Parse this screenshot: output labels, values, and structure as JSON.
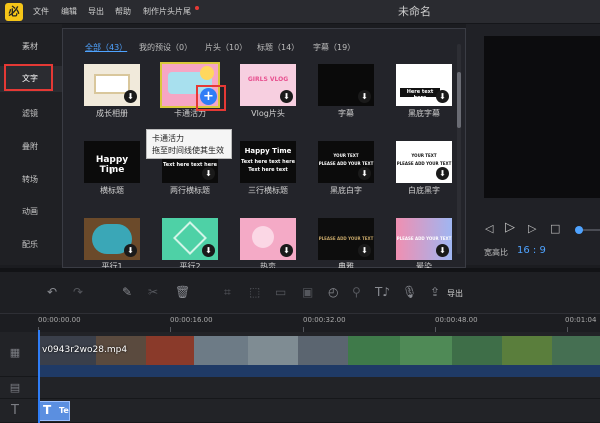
{
  "app": {
    "logo_glyph": "必",
    "title": "未命名"
  },
  "menu": {
    "file": "文件",
    "edit": "编辑",
    "export": "导出",
    "help": "帮助",
    "intro_outro": "制作片头片尾"
  },
  "sidebar": {
    "items": [
      {
        "label": "素材"
      },
      {
        "label": "文字",
        "active": true
      },
      {
        "label": "滤镜"
      },
      {
        "label": "叠附"
      },
      {
        "label": "转场"
      },
      {
        "label": "动画"
      },
      {
        "label": "配乐"
      }
    ]
  },
  "filters": [
    {
      "label": "全部（43）",
      "active": true
    },
    {
      "label": "我的预设（0）"
    },
    {
      "label": "片头（10）"
    },
    {
      "label": "标题（14）"
    },
    {
      "label": "字幕（19）"
    }
  ],
  "templates": {
    "row1": [
      {
        "caption": "成长相册"
      },
      {
        "caption": "卡通活力",
        "selected": true
      },
      {
        "caption": "Vlog片头",
        "art": "GIRLS VLOG"
      },
      {
        "caption": "字幕"
      },
      {
        "caption": "黑底字幕",
        "art": "Here text here"
      }
    ],
    "row2": [
      {
        "caption": "横标题",
        "art": "Happy Time"
      },
      {
        "caption": "两行横标题",
        "art": "Text here text here"
      },
      {
        "caption": "三行横标题",
        "art": "Happy Time",
        "art2": "Text here text here",
        "art3": "Text here text"
      },
      {
        "caption": "黑底白字",
        "art": "YOUR TEXT",
        "art2": "PLEASE ADD YOUR TEXT"
      },
      {
        "caption": "白底黑字",
        "art": "YOUR TEXT",
        "art2": "PLEASE ADD YOUR TEXT"
      }
    ],
    "row3": [
      {
        "caption": "平行1"
      },
      {
        "caption": "平行2"
      },
      {
        "caption": "热恋"
      },
      {
        "caption": "典雅",
        "art": "PLEASE ADD YOUR TEXT"
      },
      {
        "caption": "晕染",
        "art": "PLEASE ADD YOUR TEXT"
      }
    ],
    "add_glyph": "+",
    "download_glyph": "⬇"
  },
  "tooltip": {
    "line1": "卡通活力",
    "line2": "拖至时间线使其生效"
  },
  "preview": {
    "ratio_label": "宽高比",
    "ratio_value": "16 : 9"
  },
  "toolbar": {
    "export_label": "导出"
  },
  "timeline": {
    "timecodes": [
      "00:00:00.00",
      "00:00:16.00",
      "00:00:32.00",
      "00:00:48.00",
      "00:01:04"
    ],
    "clip_name": "v0943r2wo28.mp4",
    "text_clip": "T"
  },
  "colors": {
    "accent": "#2f7df6",
    "highlight": "#e53935",
    "selected_outline": "#d8c93a"
  }
}
